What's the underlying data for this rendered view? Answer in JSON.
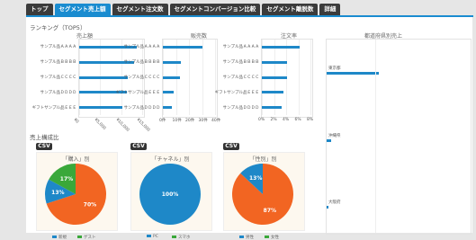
{
  "tabs": [
    "トップ",
    "セグメント売上額",
    "セグメント注文数",
    "セグメントコンバージョン比較",
    "セグメント離脱数",
    "詳細"
  ],
  "active_tab": 1,
  "ranking": {
    "title": "ランキング（TOP5）",
    "sales": {
      "title": "売上額",
      "items": [
        "サンプル品ＡＡＡＡ",
        "サンプル品ＢＢＢＢ",
        "サンプル品ＣＣＣＣ",
        "サンプル品ＤＤＤＤ",
        "ギフトサンプル品ＥＥＥ"
      ],
      "values": [
        10200,
        9600,
        8600,
        8400,
        7600
      ],
      "ticks": [
        "¥0",
        "¥5,000",
        "¥10,000",
        "¥15,000"
      ]
    },
    "orders": {
      "title": "販売数",
      "items": [
        "サンプル品ＡＡＡＡ",
        "サンプル品ＢＢＢＢ",
        "サンプル品ＣＣＣＣ",
        "ギフトサンプル品ＥＥＥ",
        "サンプル品ＤＤＤＤ"
      ],
      "values": [
        30,
        14,
        13,
        8,
        7
      ],
      "ticks": [
        "0件",
        "10件",
        "20件",
        "30件",
        "40件"
      ]
    },
    "cvr": {
      "title": "注文率",
      "items": [
        "サンプル品ＡＡＡＡ",
        "サンプル品ＢＢＢＢ",
        "サンプル品ＣＣＣＣ",
        "ギフトサンプル品ＥＥＥ",
        "サンプル品ＤＤＤＤ"
      ],
      "values": [
        6.2,
        4.2,
        4.1,
        3.6,
        3.3
      ],
      "ticks": [
        "0%",
        "2%",
        "4%",
        "6%",
        "8%"
      ]
    },
    "prefecture": {
      "title": "都道府県別売上",
      "items": [
        "東京都",
        "沖縄県",
        "大阪府"
      ],
      "values": [
        100,
        9,
        3
      ]
    }
  },
  "composition": {
    "title": "売上構成比",
    "csv_label": "CSV",
    "pies": [
      {
        "title": "「購入」別",
        "slices": [
          {
            "label": "70%",
            "value": 70,
            "color": "#f26522"
          },
          {
            "label": "13%",
            "value": 13,
            "color": "#1e88c8"
          },
          {
            "label": "17%",
            "value": 17,
            "color": "#3aa83a"
          }
        ],
        "legend": [
          "新規",
          "ゲスト"
        ]
      },
      {
        "title": "「チャネル」別",
        "slices": [
          {
            "label": "100%",
            "value": 100,
            "color": "#1e88c8"
          }
        ],
        "legend": [
          "PC",
          "スマホ"
        ]
      },
      {
        "title": "「性別」別",
        "slices": [
          {
            "label": "87%",
            "value": 87,
            "color": "#f26522"
          },
          {
            "label": "13%",
            "value": 13,
            "color": "#1e88c8"
          }
        ],
        "legend": [
          "男性",
          "女性"
        ]
      }
    ]
  }
}
